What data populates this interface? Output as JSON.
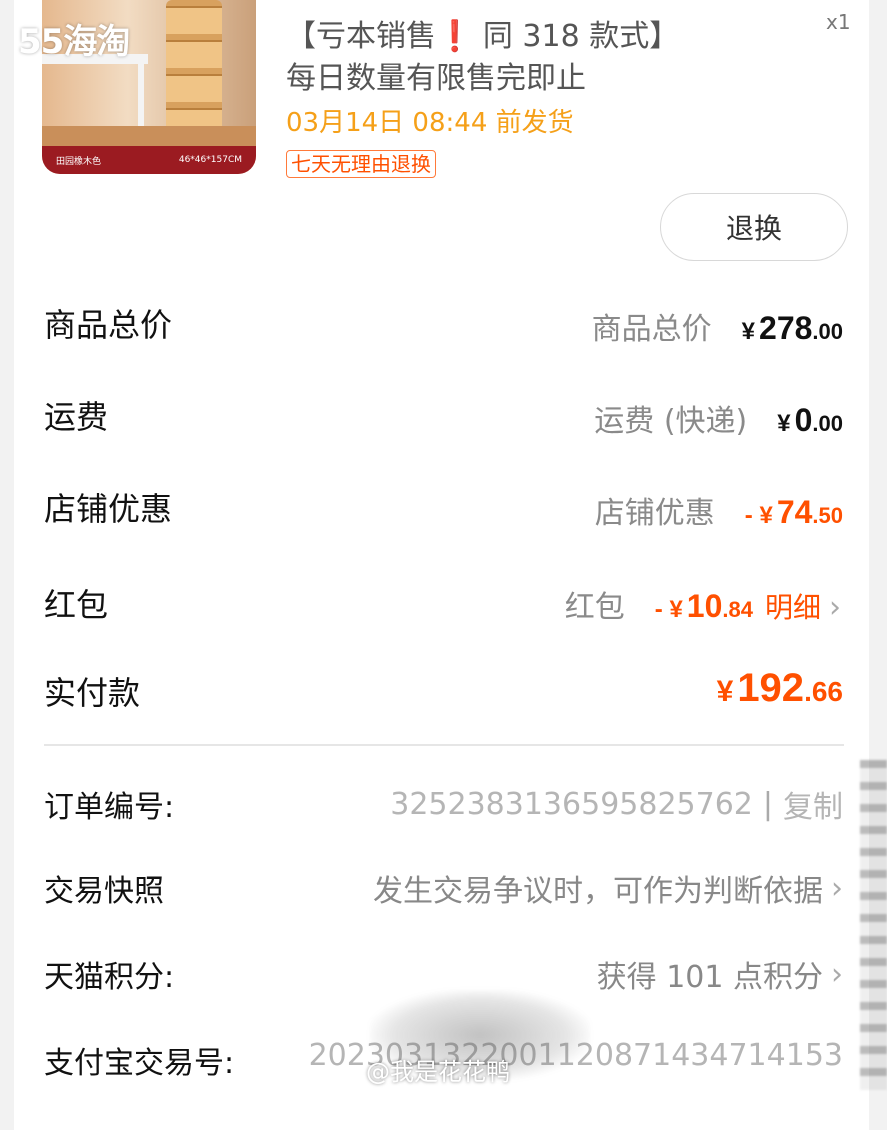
{
  "watermark_top": "55海淘",
  "product": {
    "image_tag": "田园橡木色",
    "image_size": "46*46*157CM",
    "title_part1": "【亏本销售",
    "title_exclaim": "❗",
    "title_part2": " 同 318 款式】每日数量有限售完即止",
    "quantity": "x1",
    "ship_date": "03月14日 08:44 前发货",
    "return_badge": "七天无理由退换",
    "return_button": "退换"
  },
  "price_rows": {
    "goods_total": {
      "label": "商品总价",
      "sub": "商品总价",
      "yen": "¥",
      "int": "278",
      "dec": ".00"
    },
    "shipping": {
      "label": "运费",
      "sub": "运费 (快递)",
      "yen": "¥",
      "int": "0",
      "dec": ".00"
    },
    "shop_discount": {
      "label": "店铺优惠",
      "sub": "店铺优惠",
      "yen": "- ¥",
      "int": "74",
      "dec": ".50"
    },
    "red_packet": {
      "label": "红包",
      "sub": "红包",
      "yen": "- ¥",
      "int": "10",
      "dec": ".84",
      "detail": "明细"
    },
    "paid": {
      "label": "实付款",
      "yen": "¥",
      "int": "192",
      "dec": ".66"
    }
  },
  "info_rows": {
    "order_no": {
      "label": "订单编号:",
      "value": "3252383136595825762",
      "sep": "|",
      "action": "复制"
    },
    "snapshot": {
      "label": "交易快照",
      "value": "发生交易争议时，可作为判断依据"
    },
    "points": {
      "label": "天猫积分:",
      "value": "获得 101 点积分"
    },
    "alipay_no": {
      "label": "支付宝交易号:",
      "value": "2023031322001120871434714153"
    }
  },
  "watermark_bottom": "@我是花花鸭",
  "colors": {
    "accent_orange": "#ff5000",
    "ship_date_orange": "#f5a019",
    "banner_red": "#9b1b21"
  },
  "icons": {
    "chevron": "chevron-right-icon"
  }
}
